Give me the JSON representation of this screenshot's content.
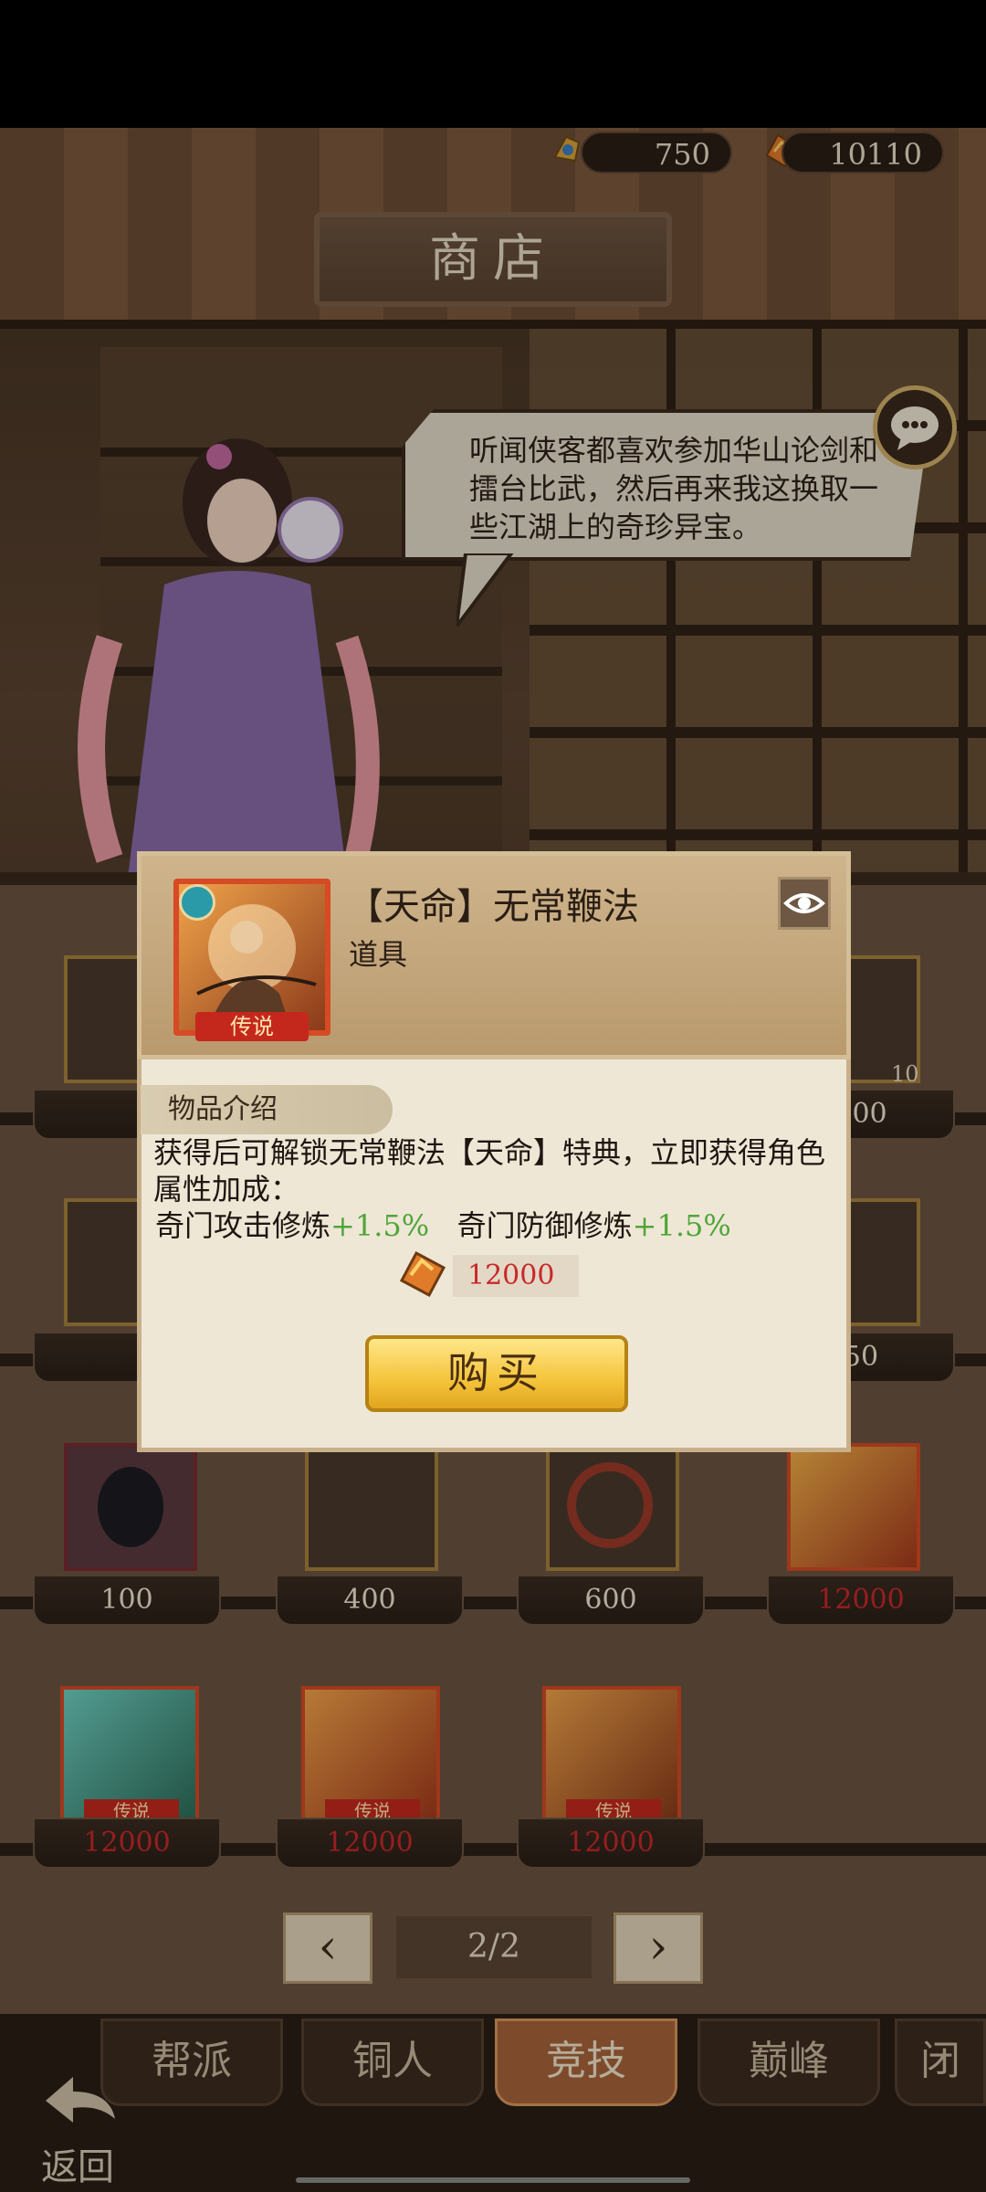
{
  "currency": {
    "jade": "750",
    "tokens": "10110"
  },
  "shop_title": "商店",
  "speech": "听闻侠客都喜欢参加华山论剑和擂台比武，然后再来我这换取一些江湖上的奇珍异宝。",
  "grid": {
    "row1": {
      "prices": [
        "",
        "",
        "",
        "500"
      ],
      "count_badge": "10"
    },
    "row2": {
      "prices": [
        "",
        "",
        "",
        "50"
      ]
    },
    "row3": {
      "prices": [
        "100",
        "400",
        "600",
        "12000"
      ]
    },
    "row4": {
      "prices": [
        "12000",
        "12000",
        "12000"
      ],
      "grade": "传说"
    }
  },
  "pager": {
    "prev": "‹",
    "page": "2/2",
    "next": "›"
  },
  "tabs": [
    "帮派",
    "铜人",
    "竞技",
    "巅峰",
    "闭"
  ],
  "active_tab": "竞技",
  "back_label": "返回",
  "modal": {
    "item_name": "【天命】无常鞭法",
    "item_type": "道具",
    "grade": "传说",
    "intro_label": "物品介绍",
    "description": "获得后可解锁无常鞭法【天命】特典，立即获得角色属性加成：",
    "stat1_label": "奇门攻击修炼",
    "stat1_value": "+1.5%",
    "stat2_label": "奇门防御修炼",
    "stat2_value": "+1.5%",
    "price": "12000",
    "buy_label": "购买"
  },
  "colors": {
    "accent_gold": "#f4c43a",
    "price_red": "#c9282a",
    "stat_green": "#4ea63a"
  }
}
